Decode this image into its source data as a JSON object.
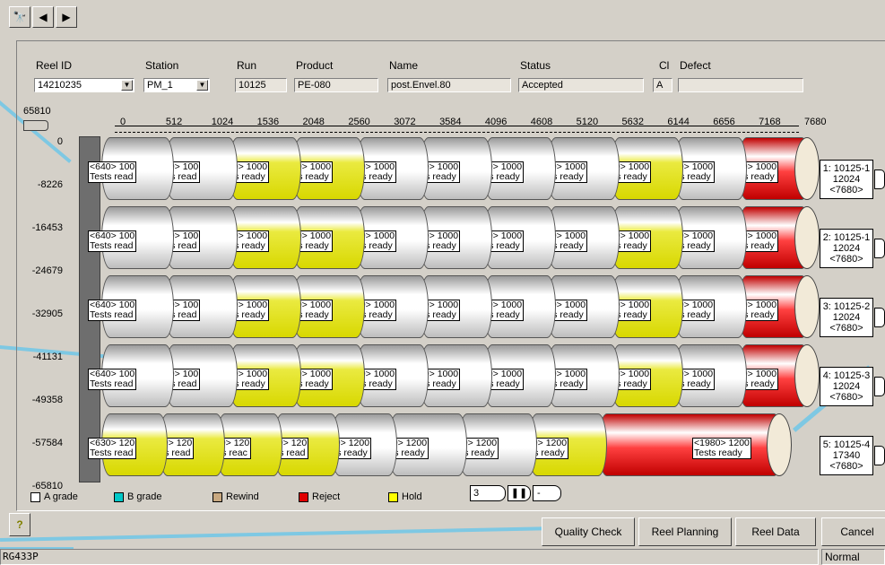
{
  "toolbar": {
    "find_icon": "binoculars-icon",
    "prev_icon": "triangle-left-icon",
    "next_icon": "triangle-right-icon"
  },
  "header": {
    "reel_id_label": "Reel ID",
    "reel_id_value": "14210235",
    "station_label": "Station",
    "station_value": "PM_1",
    "run_label": "Run",
    "run_value": "10125",
    "product_label": "Product",
    "product_value": "PE-080",
    "name_label": "Name",
    "name_value": "post.Envel.80",
    "status_label": "Status",
    "status_value": "Accepted",
    "cl_label": "Cl",
    "cl_value": "A",
    "defect_label": "Defect",
    "defect_value": ""
  },
  "chart": {
    "top_value": "65810",
    "y_ticks": [
      "0",
      "-8226",
      "-16453",
      "-24679",
      "-32905",
      "-41131",
      "-49358",
      "-57584",
      "-65810"
    ],
    "x_ticks": [
      "0",
      "512",
      "1024",
      "1536",
      "2048",
      "2560",
      "3072",
      "3584",
      "4096",
      "4608",
      "5120",
      "5632",
      "6144",
      "6656",
      "7168",
      "7680"
    ]
  },
  "reels": [
    {
      "side": [
        "1: 10125-1",
        "12024",
        "<7680>"
      ],
      "segments": [
        {
          "l1": "<640> 100",
          "l2": "Tests read",
          "c": "grey"
        },
        {
          "l1": "<640> 100",
          "l2": "Tests read",
          "c": "grey"
        },
        {
          "l1": "<640> 1000",
          "l2": "Tests ready",
          "c": "yellow"
        },
        {
          "l1": "<720> 1000",
          "l2": "Tests ready",
          "c": "yellow"
        },
        {
          "l1": "<720> 1000",
          "l2": "Tests ready",
          "c": "grey"
        },
        {
          "l1": "<720> 1000",
          "l2": "Tests ready",
          "c": "grey"
        },
        {
          "l1": "<720> 1000",
          "l2": "Tests ready",
          "c": "grey"
        },
        {
          "l1": "<720> 1000",
          "l2": "Tests ready",
          "c": "grey"
        },
        {
          "l1": "<720> 1000",
          "l2": "Tests ready",
          "c": "yellow"
        },
        {
          "l1": "<720> 1000",
          "l2": "Tests ready",
          "c": "grey"
        },
        {
          "l1": "<720> 1000",
          "l2": "Tests ready",
          "c": "red"
        }
      ]
    },
    {
      "side": [
        "2: 10125-1",
        "12024",
        "<7680>"
      ],
      "segments": [
        {
          "l1": "<640> 100",
          "l2": "Tests read",
          "c": "grey"
        },
        {
          "l1": "<640> 100",
          "l2": "Tests read",
          "c": "grey"
        },
        {
          "l1": "<640> 1000",
          "l2": "Tests ready",
          "c": "yellow"
        },
        {
          "l1": "<720> 1000",
          "l2": "Tests ready",
          "c": "yellow"
        },
        {
          "l1": "<720> 1000",
          "l2": "Tests ready",
          "c": "grey"
        },
        {
          "l1": "<720> 1000",
          "l2": "Tests ready",
          "c": "grey"
        },
        {
          "l1": "<720> 1000",
          "l2": "Tests ready",
          "c": "grey"
        },
        {
          "l1": "<720> 1000",
          "l2": "Tests ready",
          "c": "grey"
        },
        {
          "l1": "<720> 1000",
          "l2": "Tests ready",
          "c": "yellow"
        },
        {
          "l1": "<720> 1000",
          "l2": "Tests ready",
          "c": "grey"
        },
        {
          "l1": "<720> 1000",
          "l2": "Tests ready",
          "c": "red"
        }
      ]
    },
    {
      "side": [
        "3: 10125-2",
        "12024",
        "<7680>"
      ],
      "segments": [
        {
          "l1": "<640> 100",
          "l2": "Tests read",
          "c": "grey"
        },
        {
          "l1": "<640> 100",
          "l2": "Tests read",
          "c": "grey"
        },
        {
          "l1": "<640> 1000",
          "l2": "Tests ready",
          "c": "yellow"
        },
        {
          "l1": "<720> 1000",
          "l2": "Tests ready",
          "c": "yellow"
        },
        {
          "l1": "<720> 1000",
          "l2": "Tests ready",
          "c": "grey"
        },
        {
          "l1": "<720> 1000",
          "l2": "Tests ready",
          "c": "grey"
        },
        {
          "l1": "<720> 1000",
          "l2": "Tests ready",
          "c": "grey"
        },
        {
          "l1": "<720> 1000",
          "l2": "Tests ready",
          "c": "grey"
        },
        {
          "l1": "<720> 1000",
          "l2": "Tests ready",
          "c": "yellow"
        },
        {
          "l1": "<720> 1000",
          "l2": "Tests ready",
          "c": "grey"
        },
        {
          "l1": "<720> 1000",
          "l2": "Tests ready",
          "c": "red"
        }
      ]
    },
    {
      "side": [
        "4: 10125-3",
        "12024",
        "<7680>"
      ],
      "segments": [
        {
          "l1": "<640> 100",
          "l2": "Tests read",
          "c": "grey"
        },
        {
          "l1": "<640> 100",
          "l2": "Tests read",
          "c": "grey"
        },
        {
          "l1": "<640> 1000",
          "l2": "Tests ready",
          "c": "yellow"
        },
        {
          "l1": "<720> 1000",
          "l2": "Tests ready",
          "c": "yellow"
        },
        {
          "l1": "<720> 1000",
          "l2": "Tests ready",
          "c": "grey"
        },
        {
          "l1": "<720> 1000",
          "l2": "Tests ready",
          "c": "grey"
        },
        {
          "l1": "<720> 1000",
          "l2": "Tests ready",
          "c": "grey"
        },
        {
          "l1": "<720> 1000",
          "l2": "Tests ready",
          "c": "grey"
        },
        {
          "l1": "<720> 1000",
          "l2": "Tests ready",
          "c": "yellow"
        },
        {
          "l1": "<720> 1000",
          "l2": "Tests ready",
          "c": "grey"
        },
        {
          "l1": "<720> 1000",
          "l2": "Tests ready",
          "c": "red"
        }
      ]
    },
    {
      "side": [
        "5: 10125-4",
        "17340",
        "<7680>"
      ],
      "segments": [
        {
          "l1": "<630> 120",
          "l2": "Tests read",
          "c": "yellow"
        },
        {
          "l1": "<630> 120",
          "l2": "Tests read",
          "c": "yellow"
        },
        {
          "l1": "<630> 120",
          "l2": "Tests reac",
          "c": "yellow"
        },
        {
          "l1": "<630> 120",
          "l2": "Tests read",
          "c": "yellow"
        },
        {
          "l1": "<630> 1200",
          "l2": "Tests ready",
          "c": "grey"
        },
        {
          "l1": "<850> 1200",
          "l2": "Tests ready",
          "c": "grey"
        },
        {
          "l1": "<850> 1200",
          "l2": "Tests ready",
          "c": "grey"
        },
        {
          "l1": "<850> 1200",
          "l2": "Tests ready",
          "c": "yellow"
        },
        {
          "l1": "<1980> 1200",
          "l2": "Tests ready",
          "c": "red"
        }
      ]
    }
  ],
  "legend": [
    {
      "label": "A grade",
      "color": "#ffffff"
    },
    {
      "label": "B grade",
      "color": "#00c8c8"
    },
    {
      "label": "Rewind",
      "color": "#c8a880"
    },
    {
      "label": "Reject",
      "color": "#e00000"
    },
    {
      "label": "Hold",
      "color": "#ffff00"
    }
  ],
  "zoom": {
    "value": "3",
    "dash": "-"
  },
  "buttons": {
    "help": "?",
    "quality": "Quality Check",
    "planning": "Reel Planning",
    "data": "Reel Data",
    "cancel": "Cancel"
  },
  "status": {
    "left": "RG433P",
    "right": "Normal"
  }
}
